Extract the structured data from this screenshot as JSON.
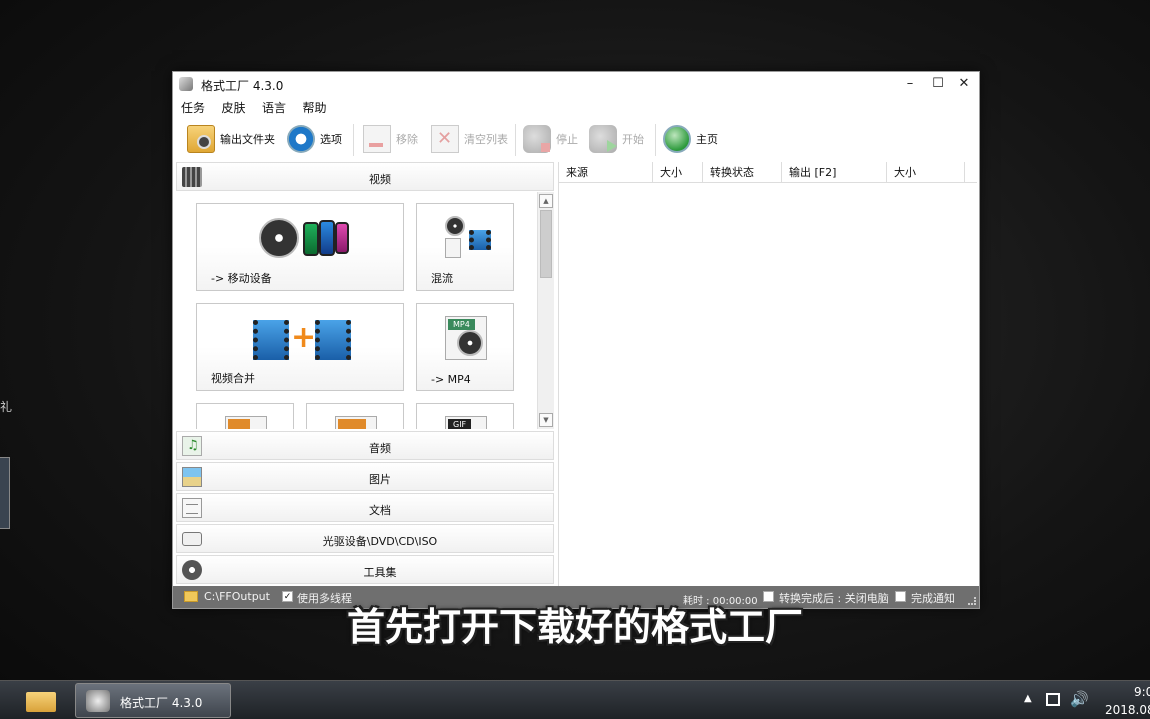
{
  "desktop": {
    "left_fragment": "礼"
  },
  "window": {
    "title": "格式工厂 4.3.0",
    "controls": {
      "minimize": "–",
      "maximize": "☐",
      "close": "✕"
    }
  },
  "menu": [
    "任务",
    "皮肤",
    "语言",
    "帮助"
  ],
  "toolbar": {
    "output_folder": "输出文件夹",
    "options": "选项",
    "remove": "移除",
    "clear_list": "清空列表",
    "stop": "停止",
    "start": "开始",
    "home": "主页"
  },
  "categories": {
    "video": "视频",
    "audio": "音频",
    "image": "图片",
    "document": "文档",
    "disc": "光驱设备\\DVD\\CD\\ISO",
    "tools": "工具集"
  },
  "video_tiles": {
    "mobile": "-> 移动设备",
    "mux": "混流",
    "merge": "视频合并",
    "mp4": "-> MP4",
    "mp4_tag": "MP4",
    "gif_tag": "GIF"
  },
  "task_columns": [
    "来源",
    "大小",
    "转换状态",
    "输出 [F2]",
    "大小"
  ],
  "statusbar": {
    "output_path": "C:\\FFOutput",
    "multithread_label": "使用多线程",
    "multithread_checked": "✓",
    "elapsed": "耗时 : 00:00:00",
    "shutdown_label": "转换完成后 : 关闭电脑",
    "notify_label": "完成通知"
  },
  "subtitle": "首先打开下载好的格式工厂",
  "taskbar": {
    "app_label": "格式工厂 4.3.0",
    "tray_arrow": "▲",
    "volume": "🔊",
    "clock_time": "9:0",
    "clock_date": "2018.08"
  }
}
